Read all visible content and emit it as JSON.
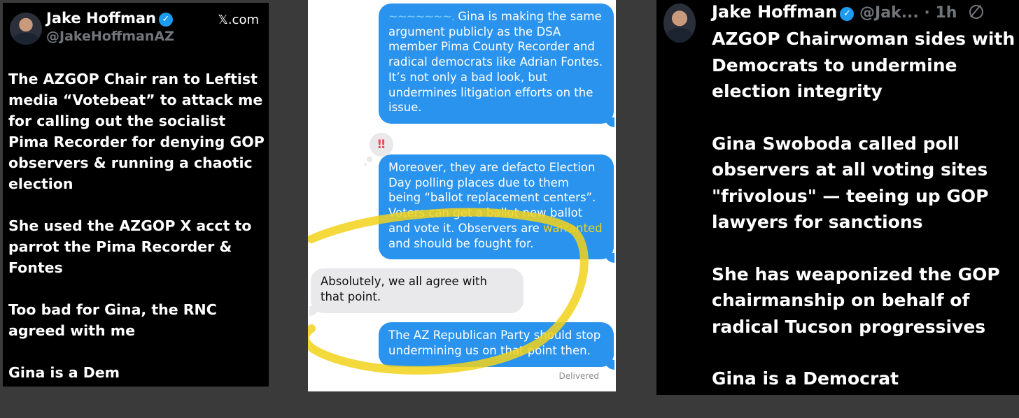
{
  "left_post": {
    "author_name": "Jake Hoffman",
    "handle": "@JakeHoffmanAZ",
    "source": "𝕏.com",
    "verified_glyph": "✓",
    "paragraphs": [
      "The AZGOP Chair ran to Leftist media “Votebeat” to attack me for calling out the socialist Pima Recorder for denying GOP observers & running a chaotic election",
      "She used the AZGOP X acct to parrot the Pima Recorder & Fontes",
      "Too bad for Gina, the RNC agreed with me",
      "Gina is a Dem"
    ]
  },
  "messages": {
    "bubble1_redacted": "~~~~~~~.",
    "bubble1_text": " Gina is making the same argument publicly as the DSA member Pima County Recorder and radical democrats like Adrian Fontes. It’s not only a bad look, but undermines litigation efforts on the issue.",
    "tapback": "‼",
    "bubble2_text": "Moreover, they are defacto Election Day polling places due to them being “ballot replacement centers”. Voters can get a ballot new ballot and vote it. Observers are ",
    "bubble2_highlight": "warranted",
    "bubble2_end": " and should be fought for.",
    "bubble3_text": "Absolutely, we all agree with that point.",
    "bubble4_text": "The AZ Republican Party should stop undermining us on that point then.",
    "status": "Delivered",
    "circle_color": "#f2d21a"
  },
  "right_post": {
    "author_name": "Jake Hoffman",
    "handle_time": "@Jak... · 1h",
    "verified_glyph": "✓",
    "menu_icon": "grok-icon",
    "paragraphs": [
      "AZGOP Chairwoman sides with Democrats to undermine election integrity",
      "Gina Swoboda called poll observers at all voting sites \"frivolous\" — teeing up GOP lawyers for sanctions",
      "She has weaponized the GOP chairmanship on behalf of radical Tucson progressives",
      "Gina is a Democrat"
    ]
  },
  "colors": {
    "imessage_blue": "#2a93ee",
    "verified_blue": "#1d9bf0",
    "handle_gray": "#71767b"
  }
}
